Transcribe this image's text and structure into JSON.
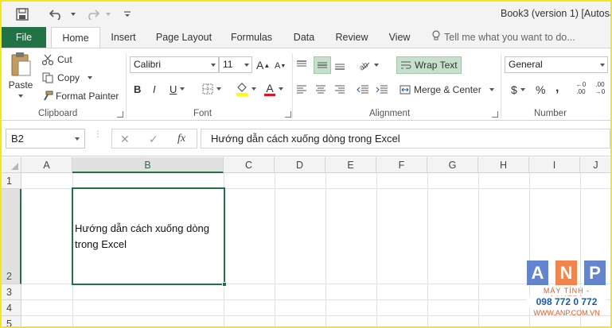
{
  "window": {
    "title": "Book3 (version 1) [Autosav"
  },
  "tabs": [
    {
      "label": "File"
    },
    {
      "label": "Home"
    },
    {
      "label": "Insert"
    },
    {
      "label": "Page Layout"
    },
    {
      "label": "Formulas"
    },
    {
      "label": "Data"
    },
    {
      "label": "Review"
    },
    {
      "label": "View"
    }
  ],
  "tellme": "Tell me what you want to do...",
  "clipboard": {
    "paste": "Paste",
    "cut": "Cut",
    "copy": "Copy",
    "format_painter": "Format Painter",
    "group": "Clipboard"
  },
  "font": {
    "name": "Calibri",
    "size": "11",
    "group": "Font",
    "bold": "B",
    "italic": "I",
    "underline": "U",
    "grow": "A",
    "shrink": "A",
    "color_letter": "A",
    "fill_color": "#ffff00",
    "font_color": "#e81123"
  },
  "alignment": {
    "wrap": "Wrap Text",
    "merge": "Merge & Center",
    "group": "Alignment"
  },
  "number": {
    "format": "General",
    "group": "Number",
    "currency": "$",
    "percent": "%",
    "comma": ",",
    "inc1": "←0",
    "inc2": ".00",
    "dec1": ".00",
    "dec2": "→0"
  },
  "formula_bar": {
    "name_box": "B2",
    "content": "Hướng dẫn cách xuống dòng trong Excel"
  },
  "grid": {
    "columns": [
      "A",
      "B",
      "C",
      "D",
      "E",
      "F",
      "G",
      "H",
      "I",
      "J"
    ],
    "rows": [
      "1",
      "2",
      "3",
      "4",
      "5"
    ],
    "cell_b2_line1": "Hướng dẫn cách xuống dòng",
    "cell_b2_line2": "trong Excel"
  },
  "watermark": {
    "letters": [
      "A",
      "N",
      "P"
    ],
    "line1": "MÁY TÍNH - CAMERA",
    "line2": "098 772 0 772",
    "line3": "WWW.ANP.COM.VN"
  },
  "colors": {
    "accent": "#217346",
    "selection": "#c6e0cc"
  }
}
